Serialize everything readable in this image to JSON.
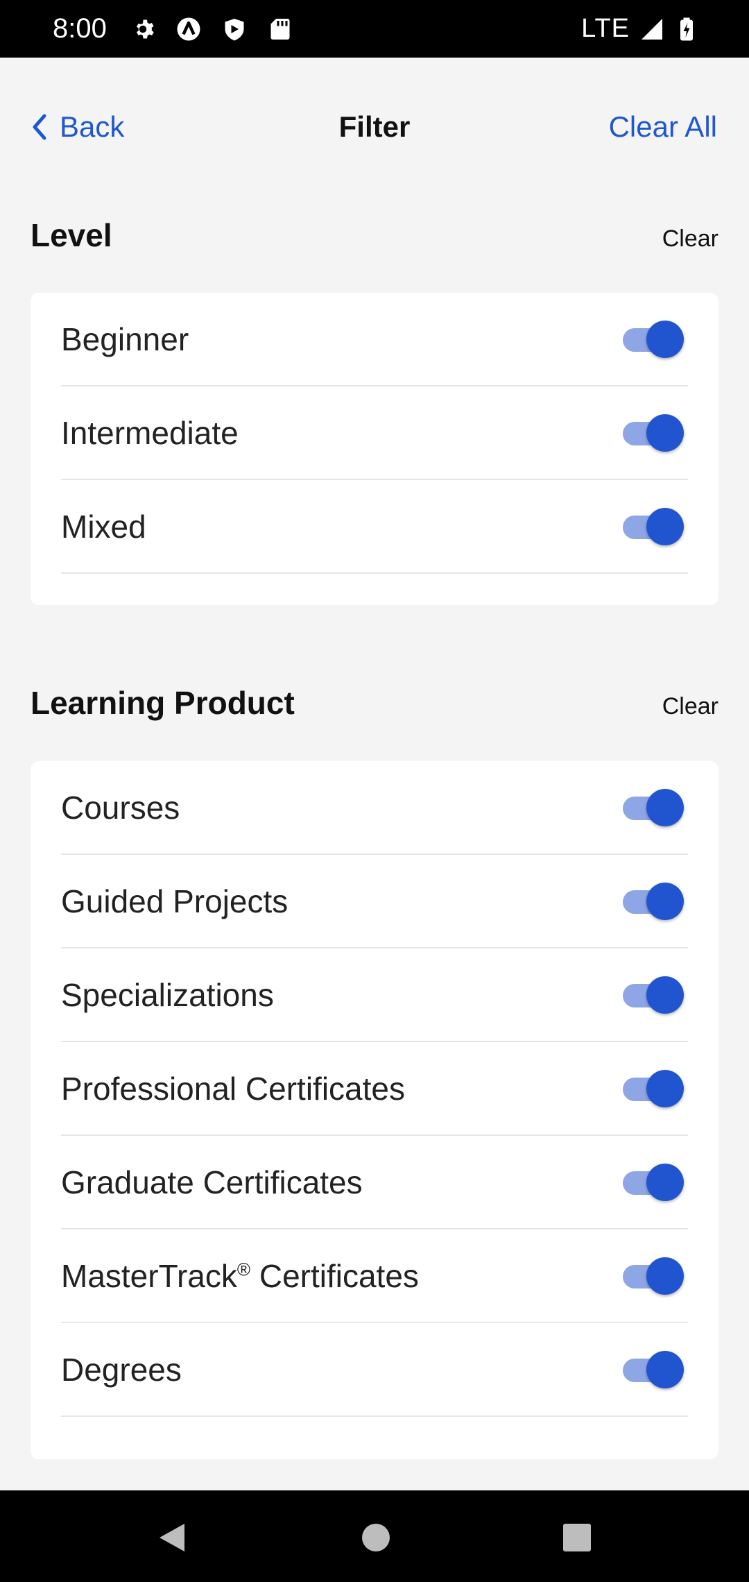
{
  "status_bar": {
    "time": "8:00",
    "network": "LTE",
    "icons_left": [
      "settings-icon",
      "app-icon",
      "shield-icon",
      "sd-card-icon"
    ],
    "icons_right": [
      "signal-icon",
      "battery-icon"
    ]
  },
  "header": {
    "back_label": "Back",
    "title": "Filter",
    "clear_all_label": "Clear All"
  },
  "sections": [
    {
      "title": "Level",
      "clear_label": "Clear",
      "items": [
        {
          "label": "Beginner",
          "on": true
        },
        {
          "label": "Intermediate",
          "on": true
        },
        {
          "label": "Mixed",
          "on": true
        }
      ]
    },
    {
      "title": "Learning Product",
      "clear_label": "Clear",
      "items": [
        {
          "label": "Courses",
          "on": true
        },
        {
          "label": "Guided Projects",
          "on": true
        },
        {
          "label": "Specializations",
          "on": true
        },
        {
          "label": "Professional Certificates",
          "on": true
        },
        {
          "label": "Graduate Certificates",
          "on": true
        },
        {
          "label": "MasterTrack",
          "suffix": "®",
          "label_rest": " Certificates",
          "on": true
        },
        {
          "label": "Degrees",
          "on": true
        }
      ]
    }
  ],
  "colors": {
    "accent": "#1f57cf",
    "toggle_knob": "#2155cf",
    "toggle_track": "#8fa6e6",
    "background": "#f4f4f4"
  }
}
